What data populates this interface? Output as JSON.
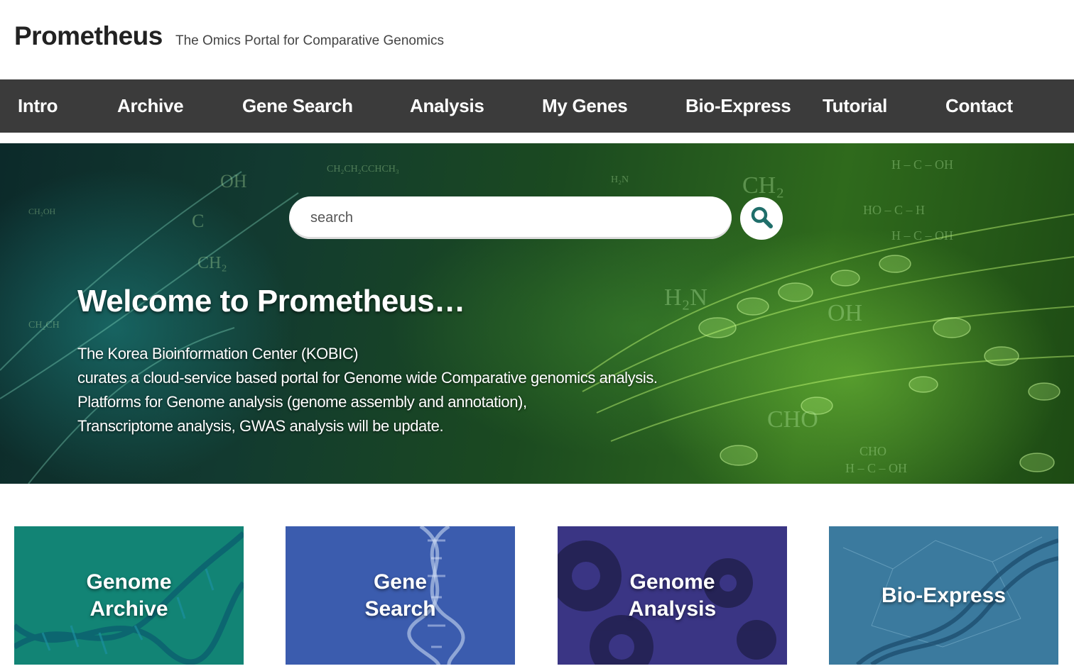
{
  "header": {
    "brand": "Prometheus",
    "tagline": "The Omics Portal for Comparative Genomics"
  },
  "nav": {
    "items": [
      {
        "label": "Intro"
      },
      {
        "label": "Archive"
      },
      {
        "label": "Gene Search"
      },
      {
        "label": "Analysis"
      },
      {
        "label": "My Genes"
      },
      {
        "label": "Bio-Express"
      },
      {
        "label": "Tutorial"
      },
      {
        "label": "Contact"
      }
    ]
  },
  "hero": {
    "search_placeholder": "search",
    "search_icon": "search-icon",
    "welcome": "Welcome to Prometheus…",
    "lines": [
      "The Korea Bioinformation Center (KOBIC)",
      "curates a cloud-service based portal for Genome wide Comparative genomics analysis.",
      "Platforms for Genome analysis (genome assembly and annotation),",
      "Transcriptome analysis, GWAS analysis will be update."
    ]
  },
  "cards": [
    {
      "label": "Genome\nArchive",
      "color": "#1a8a7a"
    },
    {
      "label": "Gene\nSearch",
      "color": "#3a5fb0"
    },
    {
      "label": "Genome\nAnalysis",
      "color": "#3a3585"
    },
    {
      "label": "Bio-Express",
      "color": "#3a7fa0"
    }
  ],
  "colors": {
    "nav_bg": "#3b3b3b",
    "search_icon": "#1f6e6a"
  }
}
